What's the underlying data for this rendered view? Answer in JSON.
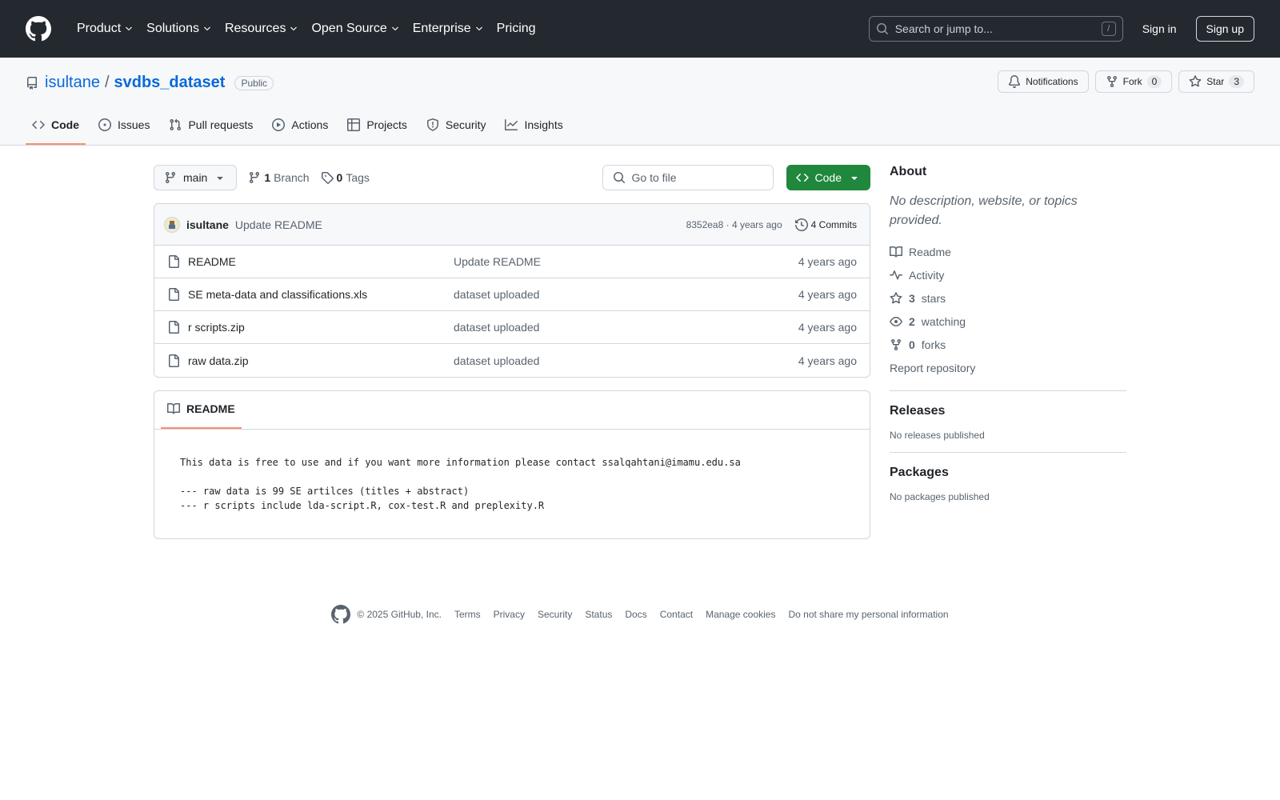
{
  "header": {
    "nav": [
      "Product",
      "Solutions",
      "Resources",
      "Open Source",
      "Enterprise",
      "Pricing"
    ],
    "search_placeholder": "Search or jump to...",
    "search_shortcut": "/",
    "signin": "Sign in",
    "signup": "Sign up"
  },
  "repo": {
    "owner": "isultane",
    "separator": "/",
    "name": "svdbs_dataset",
    "visibility": "Public",
    "notifications_label": "Notifications",
    "fork_label": "Fork",
    "fork_count": "0",
    "star_label": "Star",
    "star_count": "3"
  },
  "tabs": [
    "Code",
    "Issues",
    "Pull requests",
    "Actions",
    "Projects",
    "Security",
    "Insights"
  ],
  "filebar": {
    "branch": "main",
    "branch_count": "1",
    "branch_label": "Branch",
    "tag_count": "0",
    "tag_label": "Tags",
    "goto_placeholder": "Go to file",
    "code_button": "Code"
  },
  "latest_commit": {
    "author": "isultane",
    "message": "Update README",
    "hash_time": "8352ea8 · 4 years ago",
    "commits": "4 Commits"
  },
  "files": [
    {
      "name": "README",
      "message": "Update README",
      "date": "4 years ago"
    },
    {
      "name": "SE meta-data and classifications.xls",
      "message": "dataset uploaded",
      "date": "4 years ago"
    },
    {
      "name": "r scripts.zip",
      "message": "dataset uploaded",
      "date": "4 years ago"
    },
    {
      "name": "raw data.zip",
      "message": "dataset uploaded",
      "date": "4 years ago"
    }
  ],
  "readme": {
    "tab": "README",
    "content": "This data is free to use and if you want more information please contact ssalqahtani@imamu.edu.sa\n\n--- raw data is 99 SE artilces (titles + abstract)\n--- r scripts include lda-script.R, cox-test.R and preplexity.R"
  },
  "sidebar": {
    "about_title": "About",
    "about_desc": "No description, website, or topics provided.",
    "readme": "Readme",
    "activity": "Activity",
    "stars_count": "3",
    "stars_label": "stars",
    "watching_count": "2",
    "watching_label": "watching",
    "forks_count": "0",
    "forks_label": "forks",
    "report": "Report repository",
    "releases_title": "Releases",
    "releases_sub": "No releases published",
    "packages_title": "Packages",
    "packages_sub": "No packages published"
  },
  "footer": {
    "copyright": "© 2025 GitHub, Inc.",
    "links": [
      "Terms",
      "Privacy",
      "Security",
      "Status",
      "Docs",
      "Contact",
      "Manage cookies",
      "Do not share my personal information"
    ]
  },
  "colors": {
    "header_bg": "#24292f",
    "link": "#0969da",
    "code_button": "#1f883d",
    "active_tab_underline": "#fd8c73"
  }
}
